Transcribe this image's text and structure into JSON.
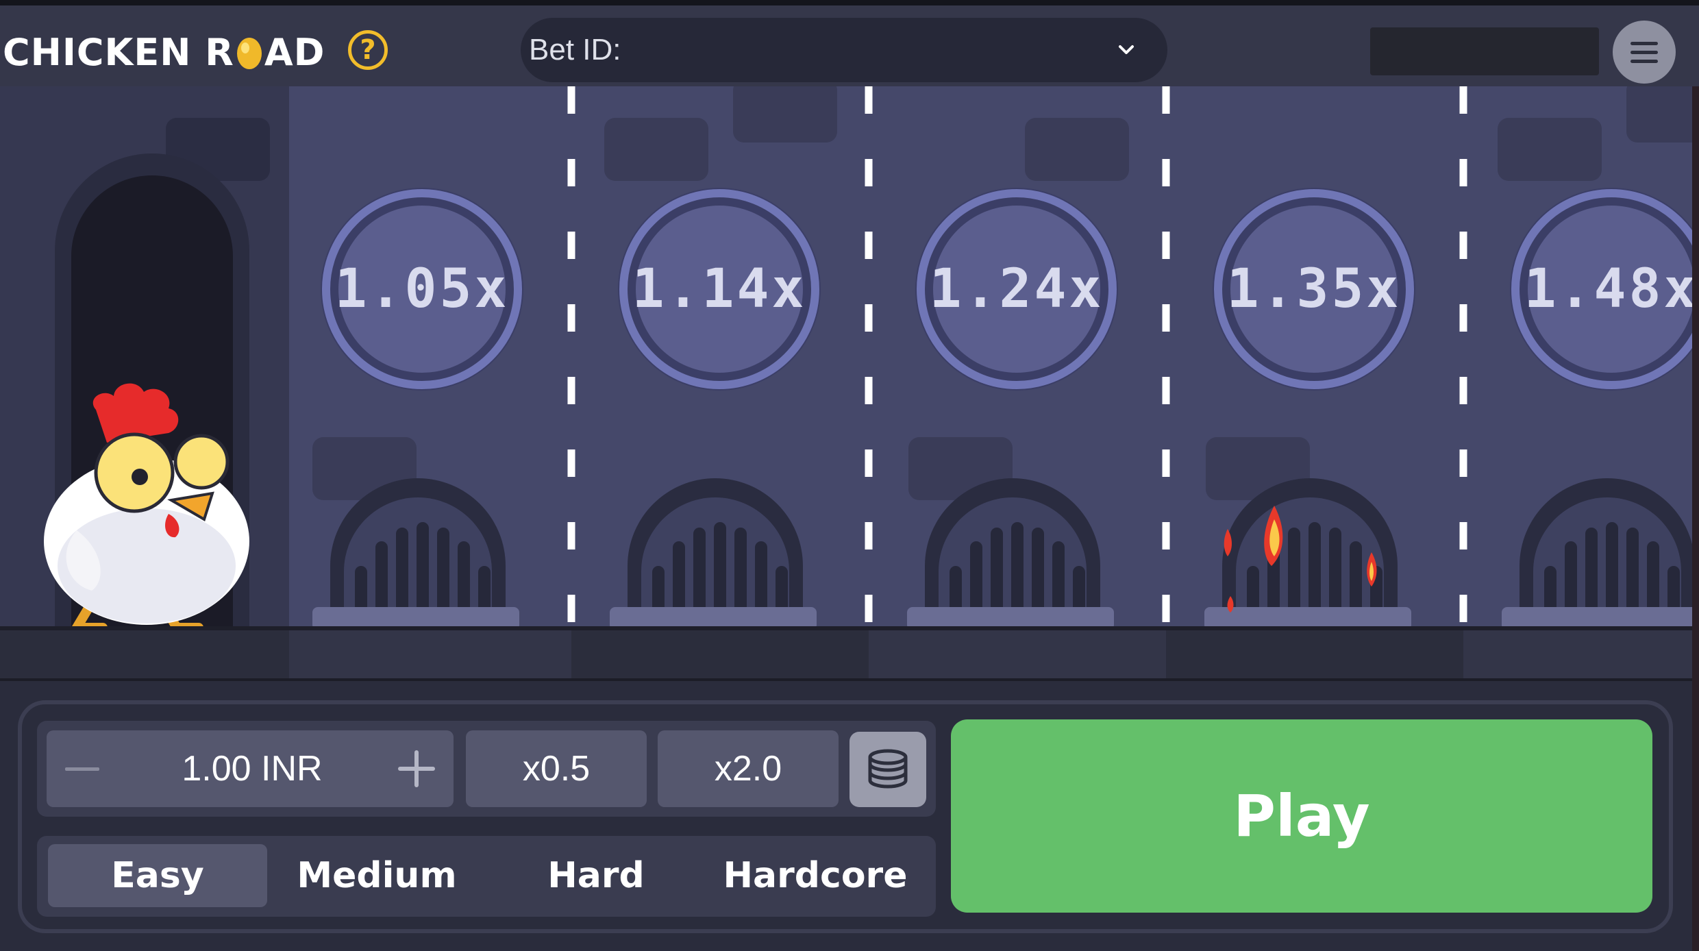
{
  "header": {
    "logo_left": "CHICKEN R",
    "logo_right": "AD",
    "help_label": "?",
    "bet_id_label": "Bet ID:",
    "bet_id_value": "",
    "balance_value": ""
  },
  "road": {
    "lanes": [
      {
        "multiplier": "1.05x",
        "flames": false
      },
      {
        "multiplier": "1.14x",
        "flames": false
      },
      {
        "multiplier": "1.24x",
        "flames": false
      },
      {
        "multiplier": "1.35x",
        "flames": true
      },
      {
        "multiplier": "1.48x",
        "flames": false
      }
    ]
  },
  "controls": {
    "bet_amount": "1.00 INR",
    "half_label": "x0.5",
    "double_label": "x2.0",
    "difficulties": [
      "Easy",
      "Medium",
      "Hard",
      "Hardcore"
    ],
    "selected_difficulty": "Easy",
    "play_label": "Play"
  },
  "colors": {
    "accent_green": "#64c06a",
    "help_yellow": "#f2bd2b",
    "scene_bg": "#45486a",
    "coin_face": "#5b5e8e"
  },
  "icons": {
    "help": "question-circle-icon",
    "dropdown": "chevron-down-icon",
    "menu": "hamburger-menu-icon",
    "coins": "coin-stack-icon"
  }
}
